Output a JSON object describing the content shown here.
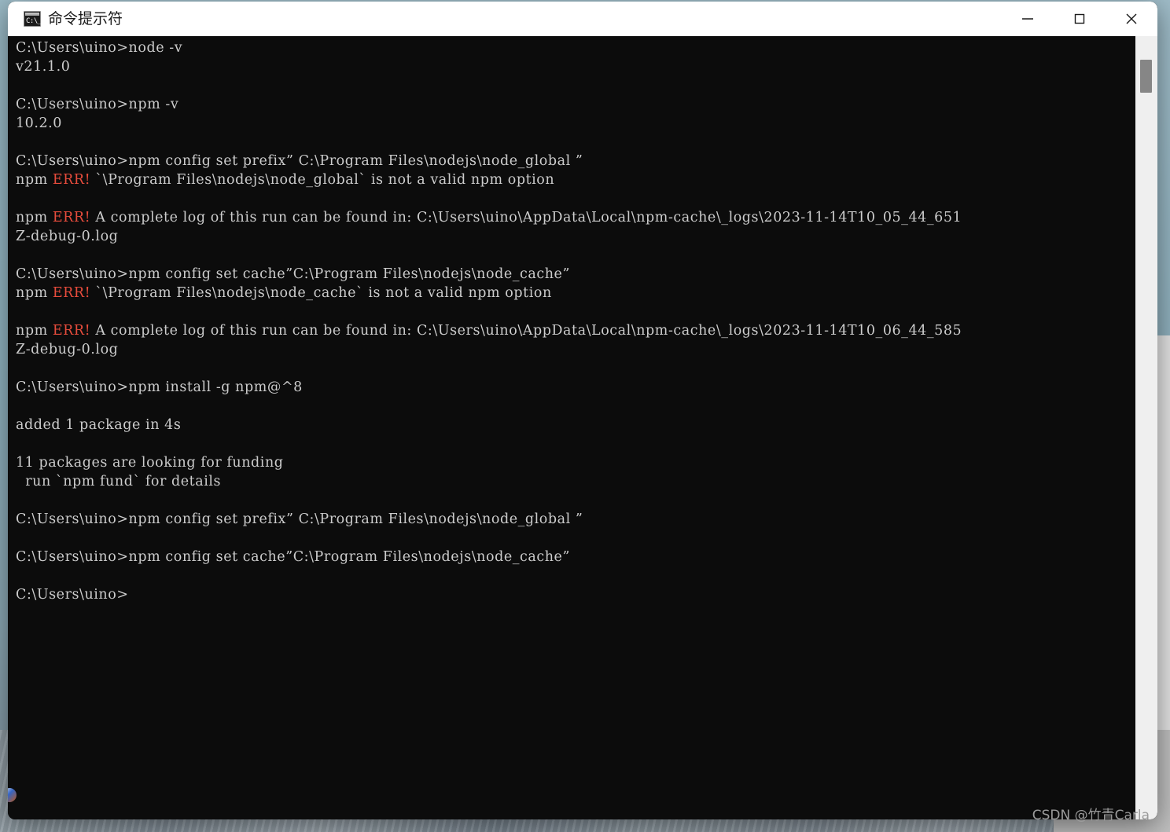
{
  "window": {
    "title": "命令提示符",
    "icon": "cmd-icon",
    "icon_glyph": "C:\\_",
    "controls": {
      "minimize_label": "Minimize",
      "maximize_label": "Maximize",
      "close_label": "Close"
    }
  },
  "terminal": {
    "background": "#0c0c0c",
    "foreground": "#cccccc",
    "error_color": "#e74c3c",
    "lines": [
      {
        "text": "C:\\Users\\uino>node -v"
      },
      {
        "text": "v21.1.0"
      },
      {
        "text": ""
      },
      {
        "text": "C:\\Users\\uino>npm -v"
      },
      {
        "text": "10.2.0"
      },
      {
        "text": ""
      },
      {
        "text": "C:\\Users\\uino>npm config set prefix” C:\\Program Files\\nodejs\\node_global ”"
      },
      {
        "pre": "npm ",
        "err": "ERR!",
        "post": " `\\Program Files\\nodejs\\node_global` is not a valid npm option"
      },
      {
        "text": ""
      },
      {
        "pre": "npm ",
        "err": "ERR!",
        "post": " A complete log of this run can be found in: C:\\Users\\uino\\AppData\\Local\\npm-cache\\_logs\\2023-11-14T10_05_44_651"
      },
      {
        "text": "Z-debug-0.log"
      },
      {
        "text": ""
      },
      {
        "text": "C:\\Users\\uino>npm config set cache”C:\\Program Files\\nodejs\\node_cache”"
      },
      {
        "pre": "npm ",
        "err": "ERR!",
        "post": " `\\Program Files\\nodejs\\node_cache` is not a valid npm option"
      },
      {
        "text": ""
      },
      {
        "pre": "npm ",
        "err": "ERR!",
        "post": " A complete log of this run can be found in: C:\\Users\\uino\\AppData\\Local\\npm-cache\\_logs\\2023-11-14T10_06_44_585"
      },
      {
        "text": "Z-debug-0.log"
      },
      {
        "text": ""
      },
      {
        "text": "C:\\Users\\uino>npm install -g npm@^8"
      },
      {
        "text": ""
      },
      {
        "text": "added 1 package in 4s"
      },
      {
        "text": ""
      },
      {
        "text": "11 packages are looking for funding"
      },
      {
        "text": "  run `npm fund` for details"
      },
      {
        "text": ""
      },
      {
        "text": "C:\\Users\\uino>npm config set prefix” C:\\Program Files\\nodejs\\node_global ”"
      },
      {
        "text": ""
      },
      {
        "text": "C:\\Users\\uino>npm config set cache”C:\\Program Files\\nodejs\\node_cache”"
      },
      {
        "text": ""
      },
      {
        "text": "C:\\Users\\uino>"
      }
    ]
  },
  "scrollbar": {
    "thumb_position": "top",
    "track_color": "#efefef",
    "thumb_color": "#868686"
  },
  "watermark": {
    "text": "CSDN @竹青Carla"
  }
}
